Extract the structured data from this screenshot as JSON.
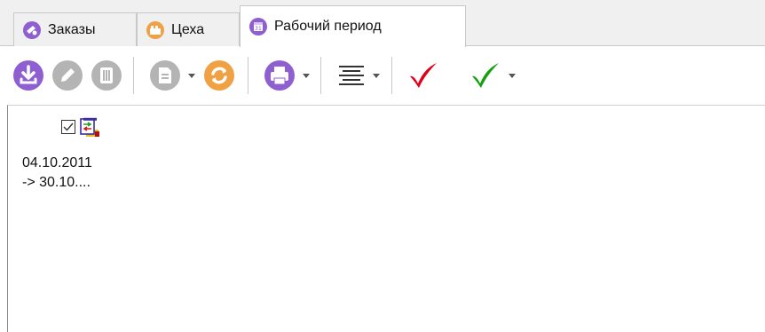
{
  "tabs": [
    {
      "label": "Заказы",
      "icon": "orders-icon",
      "active": false
    },
    {
      "label": "Цеха",
      "icon": "workshop-icon",
      "active": false
    },
    {
      "label": "Рабочий период",
      "icon": "calendar-icon",
      "active": true
    }
  ],
  "toolbar": {
    "buttons": [
      "download-icon",
      "edit-icon",
      "delete-icon",
      "document-icon",
      "refresh-icon",
      "print-icon",
      "align-icon",
      "check-red-icon",
      "check-green-icon"
    ]
  },
  "colors": {
    "purple": "#8f5fd1",
    "orange": "#f0a144",
    "gray": "#b4b4b4",
    "red_check": "#e0001a",
    "green_check": "#16a010"
  },
  "item": {
    "checked": true,
    "date_line1": "04.10.2011",
    "date_line2": "-> 30.10...."
  }
}
